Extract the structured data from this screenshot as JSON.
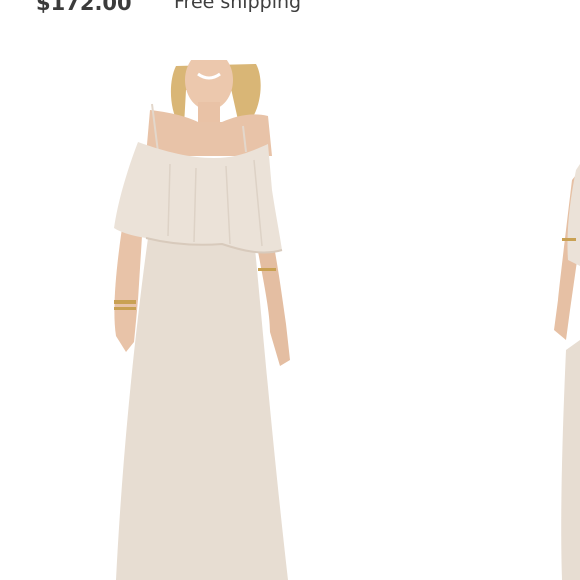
{
  "listing": {
    "price": "$172.00",
    "shipping": "Free shipping"
  },
  "gallery": {
    "images": [
      {
        "alt": "Cream off-the-shoulder ruffle maxi dress on model"
      },
      {
        "alt": "Alternate view of the dress"
      }
    ],
    "colors": {
      "dress": "#e7ddd2",
      "skin": "#e8c3a8",
      "hair": "#d9b676"
    }
  }
}
